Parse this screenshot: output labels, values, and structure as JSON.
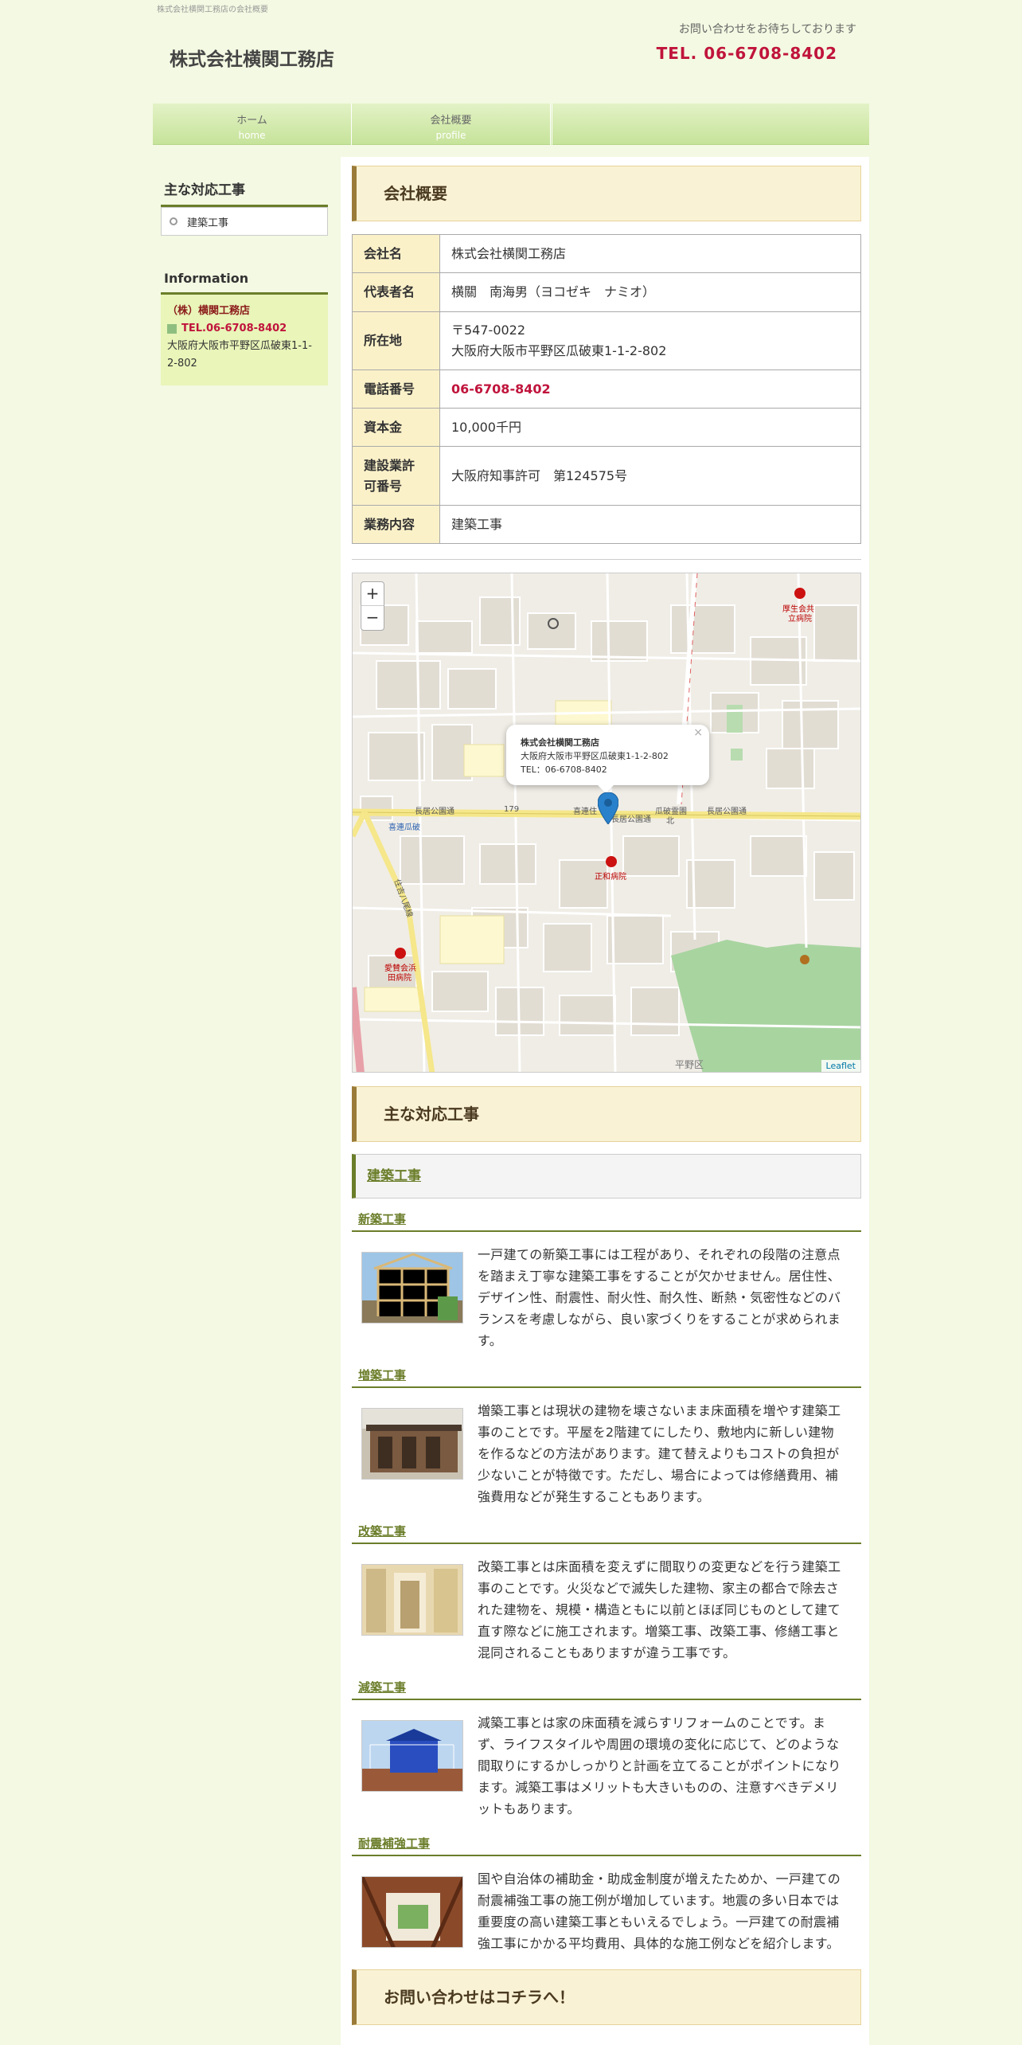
{
  "header": {
    "tagline": "株式会社横関工務店の会社概要",
    "logo": "株式会社横関工務店",
    "contact_note": "お問い合わせをお待ちしております",
    "contact_tel": "TEL. 06-6708-8402"
  },
  "nav": {
    "items": [
      {
        "label": "ホーム",
        "sub": "home"
      },
      {
        "label": "会社概要",
        "sub": "profile"
      }
    ]
  },
  "sidebar": {
    "services_title": "主な対応工事",
    "services": [
      {
        "label": "建築工事"
      }
    ],
    "info_title": "Information",
    "info_name": "（株）横関工務店",
    "info_tel": "TEL.06-6708-8402",
    "info_address": "大阪府大阪市平野区瓜破東1-1-2-802"
  },
  "profile": {
    "title": "会社概要",
    "rows": [
      {
        "key": "会社名",
        "value": "株式会社横関工務店"
      },
      {
        "key": "代表者名",
        "value": "横關　南海男（ヨコゼキ　ナミオ）"
      },
      {
        "key": "所在地",
        "value": "〒547-0022",
        "value2": "大阪府大阪市平野区瓜破東1-1-2-802"
      },
      {
        "key": "電話番号",
        "value": "06-6708-8402"
      },
      {
        "key": "資本金",
        "value": "10,000千円"
      },
      {
        "key": "建設業許",
        "key2": "可番号",
        "value": "大阪府知事許可　第124575号"
      },
      {
        "key": "業務内容",
        "value": "建築工事"
      }
    ]
  },
  "map": {
    "zoom_in": "+",
    "zoom_out": "−",
    "popup_name": "株式会社横関工務店",
    "popup_address": "大阪府大阪市平野区瓜破東1-1-2-802",
    "popup_tel": "TEL：06-6708-8402",
    "popup_close": "×",
    "attribution": "Leaflet",
    "labels": {
      "hospital1a": "厚生会共",
      "hospital1b": "立病院",
      "hospital2": "正和病院",
      "hospital3a": "愛賛会浜",
      "hospital3b": "田病院",
      "road1": "長居公園通",
      "road2": "長居公園通",
      "road3": "長居公園通",
      "road4": "179",
      "station": "喜連瓜破",
      "district": "平野区",
      "bus1": "喜連住",
      "bus2": "瓜破霊園",
      "bus2b": "北",
      "route": "住吉八尾線"
    }
  },
  "services": {
    "title": "主な対応工事",
    "category": "建築工事",
    "items": [
      {
        "title": "新築工事",
        "lines": [
          "一戸建ての新築工事には工程があり、それぞれの段階の注意点",
          "を踏まえ丁寧な建築工事をすることが欠かせません。居住性、",
          "デザイン性、耐震性、耐火性、耐久性、断熱・気密性などのバ",
          "ランスを考慮しながら、良い家づくりをすることが求められま",
          "す。"
        ]
      },
      {
        "title": "増築工事",
        "lines": [
          "増築工事とは現状の建物を壊さないまま床面積を増やす建築工",
          "事のことです。平屋を2階建てにしたり、敷地内に新しい建物",
          "を作るなどの方法があります。建て替えよりもコストの負担が",
          "少ないことが特徴です。ただし、場合によっては修繕費用、補",
          "強費用などが発生することもあります。"
        ]
      },
      {
        "title": "改築工事",
        "lines": [
          "改築工事とは床面積を変えずに間取りの変更などを行う建築工",
          "事のことです。火災などで滅失した建物、家主の都合で除去さ",
          "れた建物を、規模・構造ともに以前とほぼ同じものとして建て",
          "直す際などに施工されます。増築工事、改築工事、修繕工事と",
          "混同されることもありますが違う工事です。"
        ]
      },
      {
        "title": "減築工事",
        "lines": [
          "減築工事とは家の床面積を減らすリフォームのことです。ま",
          "ず、ライフスタイルや周囲の環境の変化に応じて、どのような",
          "間取りにするかしっかりと計画を立てることがポイントになり",
          "ます。減築工事はメリットも大きいものの、注意すべきデメリ",
          "ットもあります。"
        ]
      },
      {
        "title": "耐震補強工事",
        "lines": [
          "国や自治体の補助金・助成金制度が増えたためか、一戸建ての",
          "耐震補強工事の施工例が増加しています。地震の多い日本では",
          "重要度の高い建築工事ともいえるでしょう。一戸建ての耐震補",
          "強工事にかかる平均費用、具体的な施工例などを紹介します。"
        ]
      }
    ]
  },
  "contact": {
    "title": "お問い合わせはコチラへ！"
  }
}
